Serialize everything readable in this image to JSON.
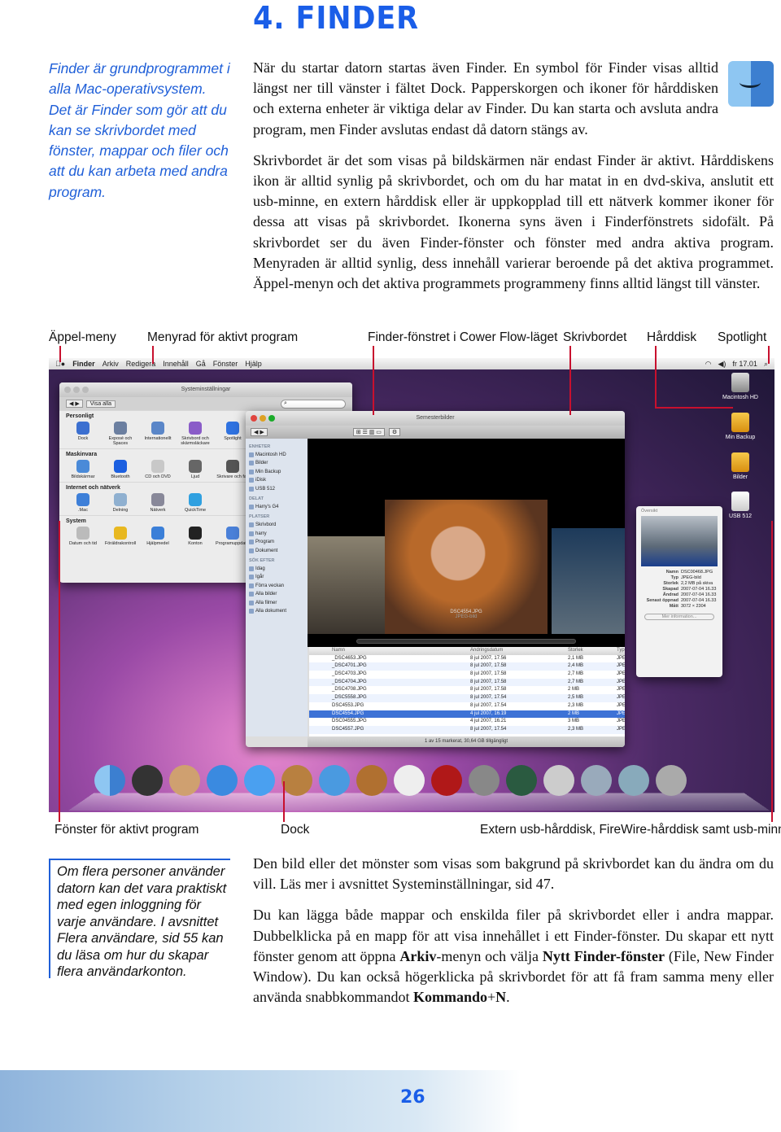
{
  "heading": "4. FINDER",
  "sidebar_text": "Finder är grundprogrammet i alla Mac-operativsystem. Det är Finder som gör att du kan se skrivbordet med fönster, mappar och filer och att du kan arbeta med andra program.",
  "intro": [
    "När du startar datorn startas även Finder. En symbol för Finder visas alltid längst ner till vänster i fältet Dock. Papperskorgen och ikoner för hårddisken och externa enheter är viktiga delar av Finder. Du kan starta och avsluta andra program, men Finder avslutas endast då datorn stängs av.",
    "Skrivbordet är det som visas på bildskärmen när endast Finder är aktivt. Hårddiskens ikon är alltid synlig på skrivbordet, och om du har matat in en dvd-skiva, anslutit ett usb-minne, en extern hårddisk eller är uppkopplad till ett nätverk kommer ikoner för dessa att visas på skrivbordet. Ikonerna syns även i Finderfönstrets sidofält. På skrivbordet ser du även Finder-fönster och fönster med andra aktiva program. Menyraden är alltid synlig, dess innehåll varierar beroende på det aktiva programmet. Äppel-menyn och det aktiva programmets programmeny finns alltid längst till vänster."
  ],
  "callouts_top": [
    "Äppel-meny",
    "Menyrad för aktivt program",
    "Finder-fönstret i Cower Flow-läget",
    "Skrivbordet",
    "Hårddisk",
    "Spotlight"
  ],
  "callouts_bottom": [
    "Fönster för aktivt program",
    "Dock",
    "Extern usb-hårddisk, FireWire-hårddisk samt usb-minne"
  ],
  "accent": "#1a5ee8",
  "callout_color": "#c8102e",
  "screenshot": {
    "menubar": {
      "app": "Finder",
      "items": [
        "Arkiv",
        "Redigera",
        "Innehåll",
        "Gå",
        "Fönster",
        "Hjälp"
      ],
      "clock": "fr 17.01"
    },
    "prefs": {
      "title": "Systeminställningar",
      "show_all": "Visa alla",
      "sections": [
        {
          "name": "Personligt",
          "items": [
            "Dock",
            "Exposé och Spaces",
            "Internationellt",
            "Skrivbord och skärmsläckare",
            "Spotlight"
          ]
        },
        {
          "name": "Maskinvara",
          "items": [
            "Bildskärmar",
            "Bluetooth",
            "CD och DVD",
            "Ljud",
            "Skrivare och fax"
          ]
        },
        {
          "name": "Internet och nätverk",
          "items": [
            ".Mac",
            "Delning",
            "Nätverk",
            "QuickTime"
          ]
        },
        {
          "name": "System",
          "items": [
            "Datum och tid",
            "Föräldrakontroll",
            "Hjälpmedel",
            "Konton",
            "Programuppdatering"
          ]
        }
      ]
    },
    "finder": {
      "title": "Semesterbilder",
      "sidebar": [
        {
          "group": "ENHETER",
          "items": [
            "Macintosh HD",
            "Bilder",
            "Min Backup",
            "iDisk",
            "USB 512"
          ]
        },
        {
          "group": "DELAT",
          "items": [
            "Harry's G4"
          ]
        },
        {
          "group": "PLATSER",
          "items": [
            "Skrivbord",
            "harry",
            "Program",
            "Dokument"
          ]
        },
        {
          "group": "SÖK EFTER",
          "items": [
            "Idag",
            "Igår",
            "Förra veckan",
            "Alla bilder",
            "Alla filmer",
            "Alla dokument"
          ]
        }
      ],
      "cover_caption": "DSC4554.JPG",
      "cover_sub": "JPEG-bild",
      "columns": [
        "Namn",
        "Ändringsdatum",
        "Storlek",
        "Typ"
      ],
      "rows": [
        [
          "_DSC4653.JPG",
          "8 jul 2007, 17.56",
          "2,1 MB",
          "JPEG-bild"
        ],
        [
          "_DSC4701.JPG",
          "8 jul 2007, 17.58",
          "2,4 MB",
          "JPEG-bild"
        ],
        [
          "_DSC4703.JPG",
          "8 jul 2007, 17.58",
          "2,7 MB",
          "JPEG-bild"
        ],
        [
          "_DSC4704.JPG",
          "8 jul 2007, 17.58",
          "2,7 MB",
          "JPEG-bild"
        ],
        [
          "_DSC4708.JPG",
          "8 jul 2007, 17.58",
          "2 MB",
          "JPEG-bild"
        ],
        [
          "_DSC5558.JPG",
          "8 jul 2007, 17.54",
          "2,5 MB",
          "JPEG-bild"
        ],
        [
          "DSC4553.JPG",
          "8 jul 2007, 17.54",
          "2,3 MB",
          "JPEG-bild"
        ],
        [
          "DSC4554.JPG",
          "4 jul 2007, 16.19",
          "2 MB",
          "JPEG-bild"
        ],
        [
          "DSC04555.JPG",
          "4 jul 2007, 16.21",
          "3 MB",
          "JPEG-bild"
        ],
        [
          "DSC4557.JPG",
          "8 jul 2007, 17.54",
          "2,3 MB",
          "JPEG-bild"
        ]
      ],
      "selected_row": 7,
      "status": "1 av 15 markerat, 30,64 GB tillgängligt"
    },
    "info": {
      "section": "Översikt",
      "fields": [
        [
          "Namn",
          "DSC00468.JPG"
        ],
        [
          "Typ",
          "JPEG-bild"
        ],
        [
          "Storlek",
          "2,2 MB på skiva"
        ],
        [
          "Skapad",
          "2007-07-04 16.33"
        ],
        [
          "Ändrad",
          "2007-07-04 16.33"
        ],
        [
          "Senast öppnad",
          "2007-07-04 16.33"
        ],
        [
          "Mått",
          "3072 × 2304"
        ]
      ],
      "more": "Mer information..."
    },
    "desktop_icons": [
      "Macintosh HD",
      "Min Backup",
      "Bilder",
      "USB 512"
    ]
  },
  "note": "Om flera personer använder datorn kan det vara praktiskt med egen inloggning för varje användare. I avsnittet Flera användare, sid 55 kan du läsa om hur du skapar flera användarkonton.",
  "outro": {
    "p1": "Den bild eller det mönster som visas som bakgrund på skrivbordet kan du ändra om du vill. Läs mer i avsnittet Systeminställningar, sid 47.",
    "p2a": "Du kan lägga både mappar och enskilda filer på skrivbordet eller i andra mappar. Dubbelklicka på en mapp för att visa innehållet i ett Finder-fönster. Du skapar ett nytt fönster genom att öppna ",
    "p2b": "Arkiv",
    "p2c": "-menyn och välja ",
    "p2d": "Nytt Finder-fönster",
    "p2e": " (File, New Finder Window). Du kan också högerklicka på skrivbordet för att få fram samma meny eller använda snabbkommandot ",
    "p2f": "Kommando",
    "p2g": "+",
    "p2h": "N",
    "p2i": "."
  },
  "page_number": "26"
}
